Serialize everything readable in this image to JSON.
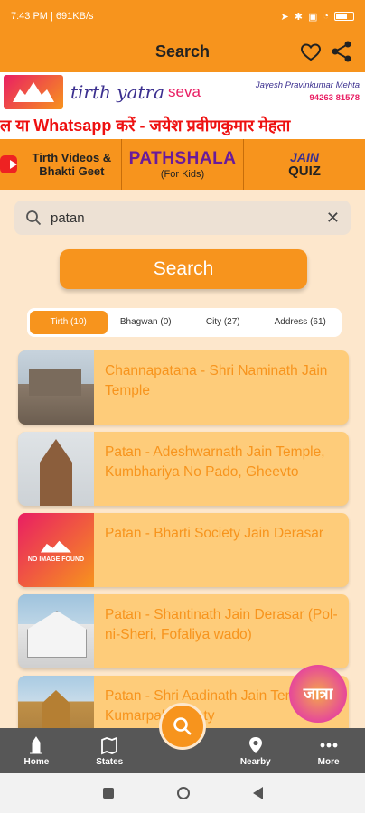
{
  "status_bar": {
    "time": "7:43 PM | 691KB/s",
    "icons": [
      "location-icon",
      "bluetooth-icon",
      "sim-icon",
      "wifi-icon",
      "battery-icon"
    ]
  },
  "app_bar": {
    "title": "Search"
  },
  "banner": {
    "brand": "tirth yatra",
    "brand_suffix": "seva",
    "contact_name": "Jayesh Pravinkumar Mehta",
    "contact_phone": "94263 81578"
  },
  "marquee": {
    "text": "ल या Whatsapp करें - जयेश प्रवीणकुमार मेहता"
  },
  "quick_links": {
    "videos": "Tirth Videos & Bhakti Geet",
    "pathshala_title": "PATHSHALA",
    "pathshala_sub": "(For Kids)",
    "quiz_top": "JAIN",
    "quiz_bottom": "QUIZ"
  },
  "search": {
    "value": "patan",
    "button_label": "Search"
  },
  "tabs": [
    {
      "label": "Tirth (10)",
      "active": true
    },
    {
      "label": "Bhagwan (0)",
      "active": false
    },
    {
      "label": "City (27)",
      "active": false
    },
    {
      "label": "Address (61)",
      "active": false
    }
  ],
  "results": [
    {
      "title": "Channapatana  - Shri Naminath Jain Temple"
    },
    {
      "title": "Patan - Adeshwarnath Jain Temple, Kumbhariya No Pado, Gheevto"
    },
    {
      "title": "Patan - Bharti Society Jain Derasar",
      "no_image_label": "NO IMAGE FOUND"
    },
    {
      "title": "Patan - Shantinath Jain Derasar (Pol-ni-Sheri, Fofaliya wado)"
    },
    {
      "title": "Patan - Shri Aadinath Jain Temple, Kumarpal Society"
    }
  ],
  "yatra_button": {
    "label": "जात्रा"
  },
  "bottom_nav": {
    "home": "Home",
    "states": "States",
    "nearby": "Nearby",
    "more": "More"
  },
  "colors": {
    "primary": "#f7941d",
    "background": "#fde7cc",
    "card": "#fecc7a",
    "nav": "#575757"
  }
}
